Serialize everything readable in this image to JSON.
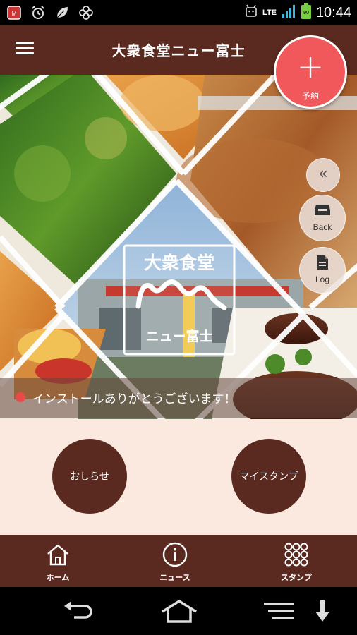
{
  "status_bar": {
    "time": "10:44",
    "network": "LTE",
    "left_icons": [
      "antivirus-shield-icon",
      "alarm-clock-icon",
      "leaf-icon",
      "flower-icon"
    ]
  },
  "app_bar": {
    "title": "大衆食堂ニュー富士"
  },
  "hero": {
    "logo_line1": "大衆食堂",
    "logo_line2": "ニュー富士",
    "install_message": "インストールありがとうございます！"
  },
  "fab": {
    "plus": "+",
    "label": "予約"
  },
  "side_menu": {
    "collapse": "«",
    "back_label": "Back",
    "log_label": "Log"
  },
  "content": {
    "news_button": "おしらせ",
    "stamp_button": "マイスタンプ"
  },
  "tabs": [
    {
      "label": "ホーム",
      "icon": "home-icon"
    },
    {
      "label": "ニュース",
      "icon": "info-icon"
    },
    {
      "label": "スタンプ",
      "icon": "stamp-grid-icon"
    }
  ],
  "colors": {
    "primary": "#5a2a20",
    "accent": "#f0585b",
    "content_bg": "#fbe9df"
  }
}
